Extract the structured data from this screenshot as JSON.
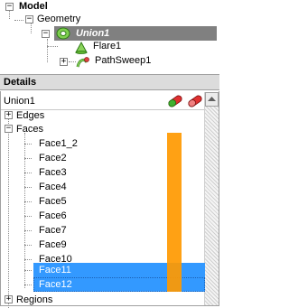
{
  "model_tree": {
    "root_label": "Model",
    "geometry_label": "Geometry",
    "union_label": "Union1",
    "children": [
      {
        "label": "Flare1"
      },
      {
        "label": "PathSweep1"
      }
    ]
  },
  "details": {
    "header_label": "Details",
    "object_label": "Union1",
    "edges_label": "Edges",
    "faces_label": "Faces",
    "faces": [
      {
        "label": "Face1_2",
        "selected": false
      },
      {
        "label": "Face2",
        "selected": false
      },
      {
        "label": "Face3",
        "selected": false
      },
      {
        "label": "Face4",
        "selected": false
      },
      {
        "label": "Face5",
        "selected": false
      },
      {
        "label": "Face6",
        "selected": false
      },
      {
        "label": "Face7",
        "selected": false
      },
      {
        "label": "Face9",
        "selected": false
      },
      {
        "label": "Face10",
        "selected": false
      },
      {
        "label": "Face11",
        "selected": true
      },
      {
        "label": "Face12",
        "selected": true
      }
    ],
    "regions_label": "Regions"
  },
  "colors": {
    "selection": "#3399ff",
    "highlight_bar": "#ff9900",
    "union_bg": "#808080",
    "panel_header": "#dcdcdc"
  },
  "icons": {
    "geometry": "green-ring-icon",
    "union": "green-ring-icon",
    "flare": "green-cone-icon",
    "path_sweep": "green-sweep-icon",
    "show_all": "pill-green-icon",
    "hide_all": "pill-red-icon"
  }
}
